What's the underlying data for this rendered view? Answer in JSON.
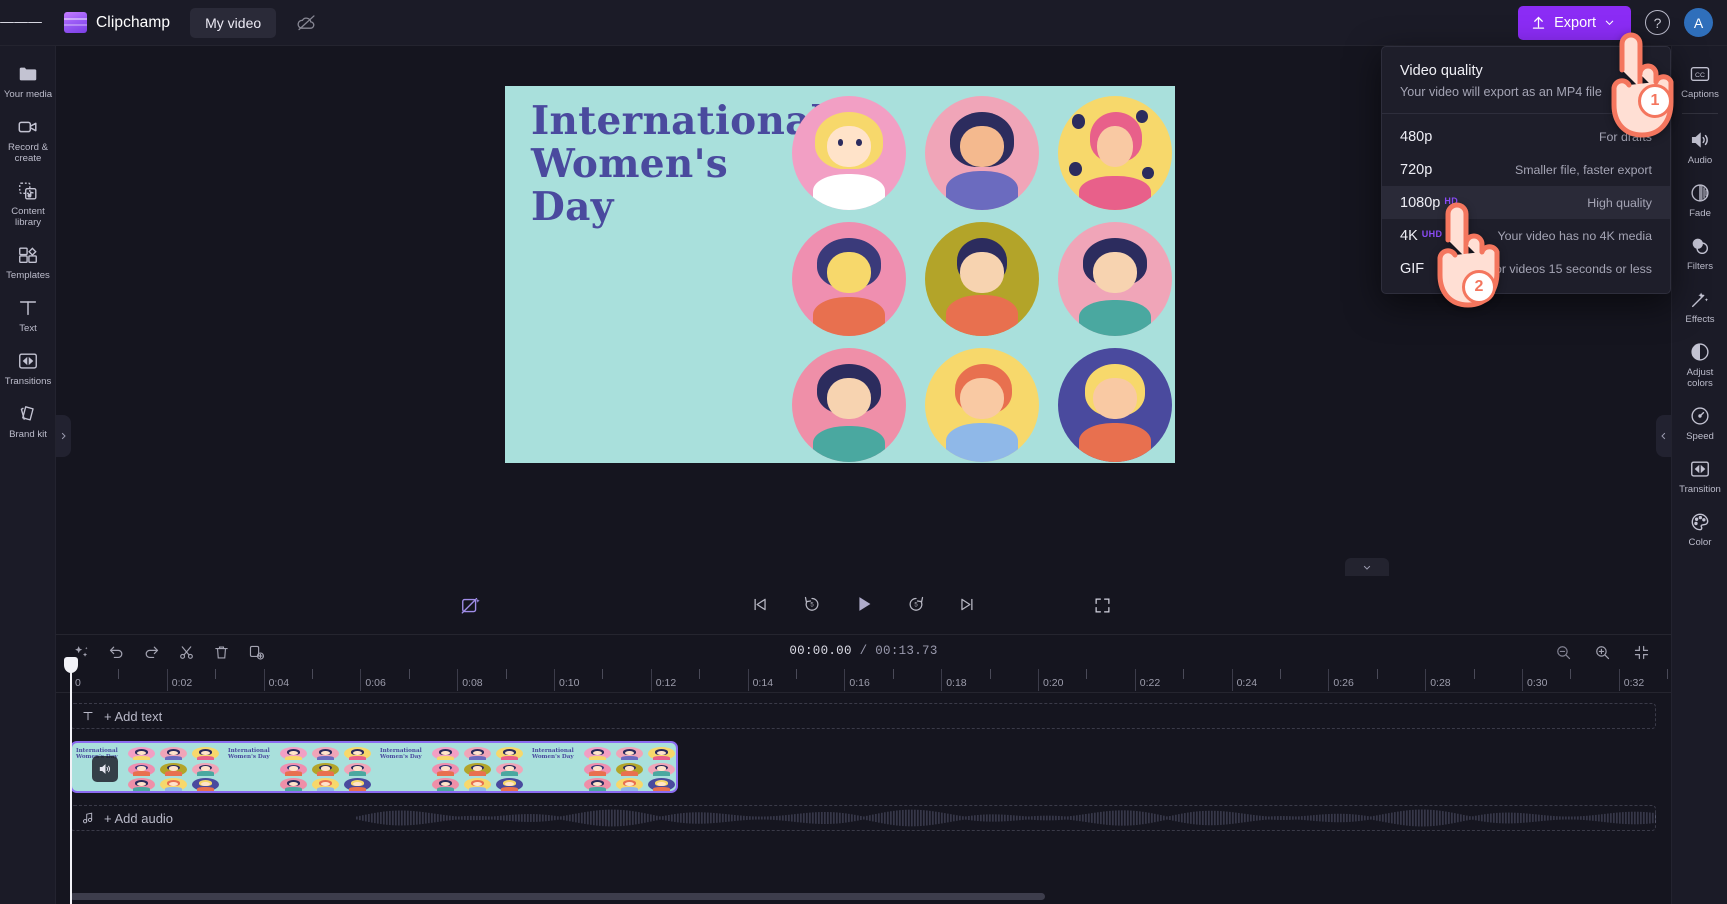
{
  "app": {
    "brand": "Clipchamp",
    "project_tab": "My video",
    "cloud_icon": "cloud-off-icon",
    "menu_icon": "hamburger-menu-icon"
  },
  "topbar": {
    "export_label": "Export",
    "export_icon": "upload-icon",
    "export_chevron": "chevron-down-icon",
    "help_icon": "help-circle-icon",
    "help_label": "?",
    "avatar_initial": "A",
    "accent": "#8b2cf5"
  },
  "left_rail": {
    "items": [
      {
        "label": "Your media",
        "icon": "folder-icon"
      },
      {
        "label": "Record & create",
        "icon": "video-camera-icon"
      },
      {
        "label": "Content library",
        "icon": "content-library-icon"
      },
      {
        "label": "Templates",
        "icon": "templates-grid-icon"
      },
      {
        "label": "Text",
        "icon": "text-t-icon"
      },
      {
        "label": "Transitions",
        "icon": "transitions-icon"
      },
      {
        "label": "Brand kit",
        "icon": "brand-kit-icon"
      }
    ],
    "collapse_icon": "chevron-right-icon"
  },
  "right_rail": {
    "items": [
      {
        "label": "Captions",
        "icon": "closed-captions-icon"
      },
      {
        "label": "Audio",
        "icon": "speaker-icon"
      },
      {
        "label": "Fade",
        "icon": "fade-icon"
      },
      {
        "label": "Filters",
        "icon": "filters-icon"
      },
      {
        "label": "Effects",
        "icon": "magic-wand-icon"
      },
      {
        "label": "Adjust colors",
        "icon": "adjust-colors-icon"
      },
      {
        "label": "Speed",
        "icon": "speedometer-icon"
      },
      {
        "label": "Transition",
        "icon": "transition-icon"
      },
      {
        "label": "Color",
        "icon": "color-palette-icon"
      }
    ],
    "collapse_icon": "chevron-left-icon"
  },
  "preview": {
    "video_title": "International Women's Day",
    "canvas_bg": "#a9e0dc",
    "title_color": "#4a4a9e"
  },
  "player": {
    "remove_bg_icon": "remove-background-icon",
    "skip_start_icon": "skip-to-start-icon",
    "back5_icon": "rewind-5-seconds-icon",
    "play_icon": "play-icon",
    "forward5_icon": "forward-5-seconds-icon",
    "skip_end_icon": "skip-to-end-icon",
    "fullscreen_icon": "fullscreen-icon",
    "collapse_icon": "chevron-down-icon"
  },
  "timeline": {
    "tools": [
      {
        "icon": "auto-compose-sparkle-icon",
        "name": "auto-compose"
      },
      {
        "icon": "undo-icon",
        "name": "undo"
      },
      {
        "icon": "redo-icon",
        "name": "redo"
      },
      {
        "icon": "scissors-icon",
        "name": "split"
      },
      {
        "icon": "trash-icon",
        "name": "delete"
      },
      {
        "icon": "duplicate-icon",
        "name": "duplicate"
      }
    ],
    "current_time": "00:00.00",
    "total_time": "00:13.73",
    "time_separator": "/",
    "zoom_out_icon": "zoom-out-icon",
    "zoom_in_icon": "zoom-in-icon",
    "fit_icon": "fit-to-screen-icon",
    "ruler_labels": [
      "0",
      "0:02",
      "0:04",
      "0:06",
      "0:08",
      "0:10",
      "0:12",
      "0:14",
      "0:16",
      "0:18",
      "0:20",
      "0:22",
      "0:24",
      "0:26",
      "0:28",
      "0:30",
      "0:32"
    ],
    "add_text_label": "+ Add text",
    "add_text_icon": "text-t-icon",
    "add_audio_label": "+ Add audio",
    "add_audio_icon": "music-note-icon",
    "clip_audio_icon": "speaker-icon",
    "clip_selected": true
  },
  "export_dropdown": {
    "title": "Video quality",
    "subtitle": "Your video will export as an MP4 file",
    "options": [
      {
        "label": "480p",
        "tag": "",
        "desc": "For drafts",
        "active": false
      },
      {
        "label": "720p",
        "tag": "",
        "desc": "Smaller file, faster export",
        "active": false
      },
      {
        "label": "1080p",
        "tag": "HD",
        "desc": "High quality",
        "active": true
      },
      {
        "label": "4K",
        "tag": "UHD",
        "desc": "Your video has no 4K media",
        "active": false
      },
      {
        "label": "GIF",
        "tag": "",
        "desc": "For videos 15 seconds or less",
        "active": false
      }
    ],
    "tag_color": "#8b4cf7"
  },
  "callouts": [
    {
      "number": "1"
    },
    {
      "number": "2"
    }
  ]
}
